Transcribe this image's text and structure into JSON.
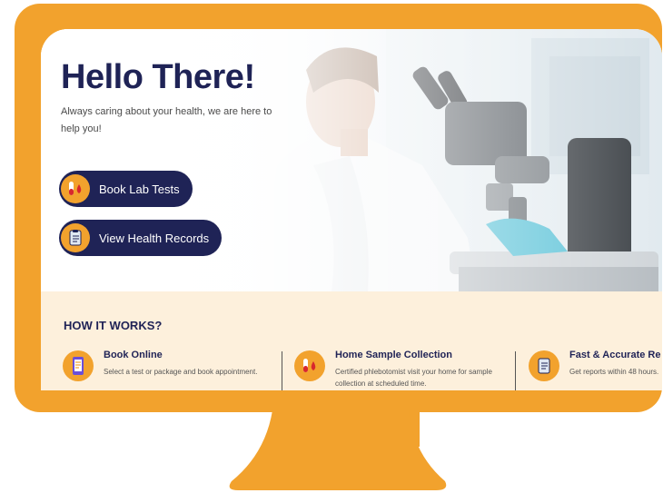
{
  "hero": {
    "title": "Hello There!",
    "subtitle": "Always caring about your health, we are here to help you!",
    "buttons": [
      {
        "label": "Book Lab Tests",
        "icon": "blood-test-tubes-icon"
      },
      {
        "label": "View Health Records",
        "icon": "clipboard-report-icon"
      }
    ]
  },
  "how_it_works": {
    "title": "HOW IT WORKS?",
    "steps": [
      {
        "title": "Book Online",
        "description": "Select a test or package and book appointment.",
        "icon": "phone-checklist-icon"
      },
      {
        "title": "Home Sample Collection",
        "description": "Certified phlebotomist visit your home for sample collection at scheduled time.",
        "icon": "blood-test-tubes-icon"
      },
      {
        "title": "Fast & Accurate Re",
        "description": "Get reports within 48 hours.",
        "icon": "report-document-icon"
      }
    ]
  },
  "colors": {
    "accent": "#f2a22d",
    "brand": "#1f2356",
    "section_bg": "#fdf0dc"
  }
}
